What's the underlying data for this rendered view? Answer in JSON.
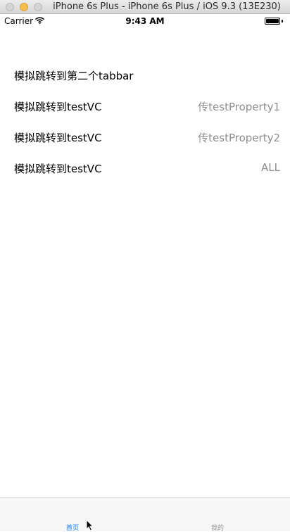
{
  "window": {
    "title": "iPhone 6s Plus - iPhone 6s Plus / iOS 9.3 (13E230)"
  },
  "status_bar": {
    "carrier": "Carrier",
    "wifi_icon": "wifi-icon",
    "time": "9:43 AM",
    "battery_icon": "battery-icon",
    "battery_level": 1.0
  },
  "list": {
    "rows": [
      {
        "title": "模拟跳转到第二个tabbar",
        "detail": ""
      },
      {
        "title": "模拟跳转到testVC",
        "detail": "传testProperty1"
      },
      {
        "title": "模拟跳转到testVC",
        "detail": "传testProperty2"
      },
      {
        "title": "模拟跳转到testVC",
        "detail": "ALL"
      }
    ]
  },
  "tab_bar": {
    "items": [
      {
        "label": "首页",
        "selected": true
      },
      {
        "label": "我的",
        "selected": false
      }
    ],
    "active_color": "#147efb",
    "inactive_color": "#929292"
  },
  "colors": {
    "background": "#ffffff",
    "detail_text": "#8e8e93",
    "tab_bar_bg": "#f7f7f7"
  }
}
